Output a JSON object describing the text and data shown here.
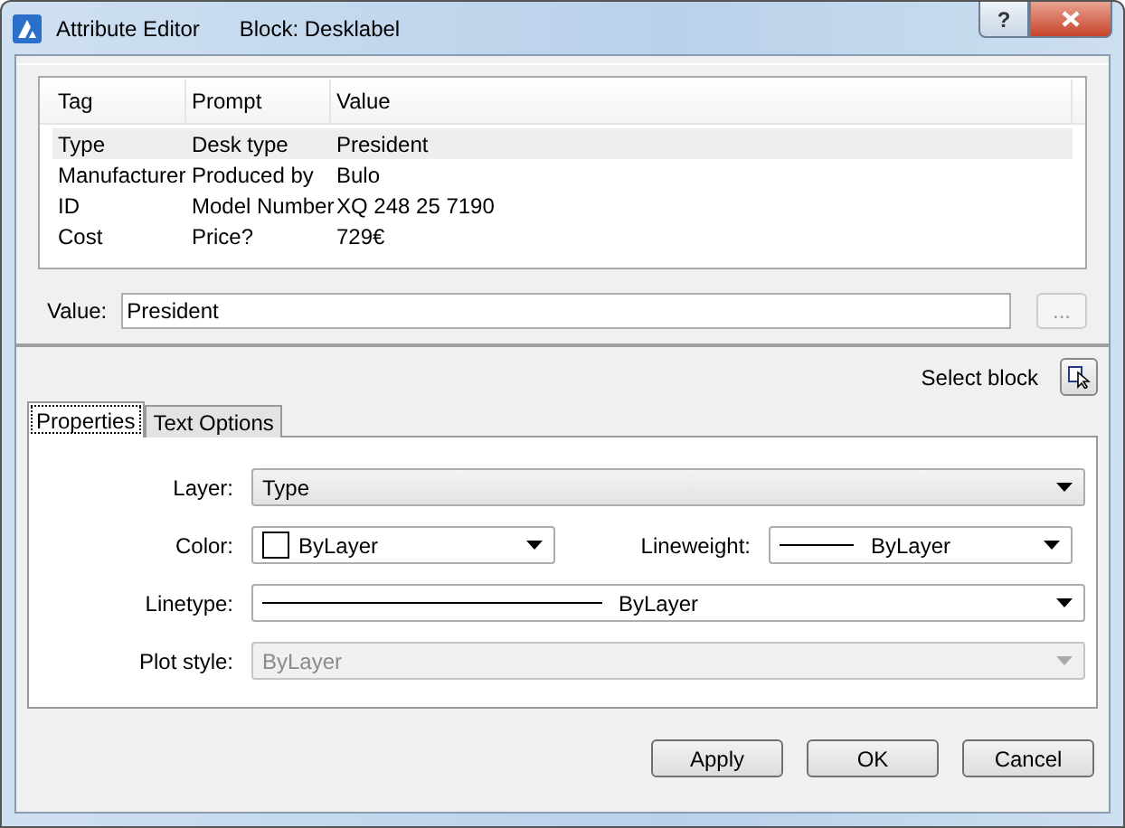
{
  "window": {
    "title": "Attribute Editor",
    "subtitle": "Block: Desklabel",
    "help_button": "?"
  },
  "table": {
    "columns": [
      "Tag",
      "Prompt",
      "Value"
    ],
    "rows": [
      {
        "cells": [
          "Type",
          "Desk type",
          "President"
        ],
        "selected": true
      },
      {
        "cells": [
          "Manufacturer",
          "Produced by",
          "Bulo"
        ],
        "selected": false
      },
      {
        "cells": [
          "ID",
          "Model Number",
          "XQ 248 25 7190"
        ],
        "selected": false
      },
      {
        "cells": [
          "Cost",
          "Price?",
          "729€"
        ],
        "selected": false
      }
    ]
  },
  "value_field": {
    "label": "Value:",
    "value": "President",
    "browse_button": "..."
  },
  "select_block": {
    "label": "Select block"
  },
  "tabs": [
    {
      "label": "Properties",
      "selected": true
    },
    {
      "label": "Text Options",
      "selected": false
    }
  ],
  "property_rows": [
    {
      "fields": [
        {
          "kind": "plain",
          "label": "Layer:",
          "value": "Type",
          "disabled": false
        }
      ]
    },
    {
      "fields": [
        {
          "kind": "swatch",
          "label": "Color:",
          "value": "ByLayer",
          "disabled": false
        },
        {
          "kind": "line",
          "label": "Lineweight:",
          "value": "ByLayer",
          "disabled": false
        }
      ]
    },
    {
      "fields": [
        {
          "kind": "line",
          "label": "Linetype:",
          "value": "ByLayer",
          "disabled": false
        }
      ]
    },
    {
      "fields": [
        {
          "kind": "plain",
          "label": "Plot style:",
          "value": "ByLayer",
          "disabled": true
        }
      ]
    }
  ],
  "buttons": [
    {
      "label": "Apply"
    },
    {
      "label": "OK"
    },
    {
      "label": "Cancel"
    }
  ]
}
